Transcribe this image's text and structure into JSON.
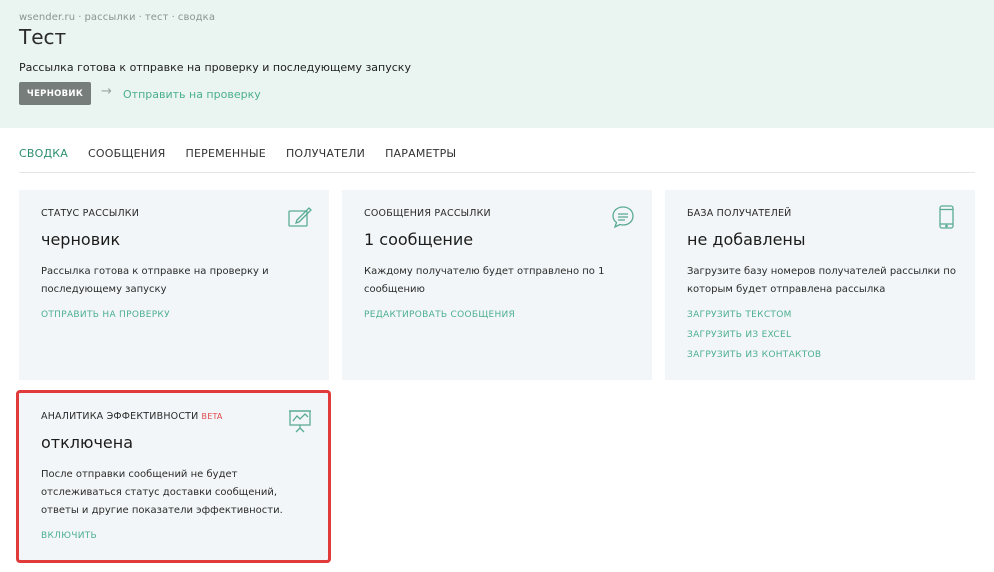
{
  "breadcrumb": [
    "wsender.ru",
    "рассылки",
    "тест",
    "сводка"
  ],
  "breadcrumb_separator": "·",
  "page_title": "Тест",
  "status_line": "Рассылка готова к отправке на проверку и последующему запуску",
  "status_pill": "ЧЕРНОВИК",
  "arrow": "→",
  "send_link": "Отправить на проверку",
  "tabs": [
    "СВОДКА",
    "СООБЩЕНИЯ",
    "ПЕРЕМЕННЫЕ",
    "ПОЛУЧАТЕЛИ",
    "ПАРАМЕТРЫ"
  ],
  "active_tab": "СВОДКА",
  "cards": [
    {
      "title": "СТАТУС РАССЫЛКИ",
      "value": "черновик",
      "description": "Рассылка готова к отправке на проверку и последующему запуску",
      "links": [
        "ОТПРАВИТЬ НА ПРОВЕРКУ"
      ],
      "icon": "edit-icon"
    },
    {
      "title": "СООБЩЕНИЯ РАССЫЛКИ",
      "value": "1 сообщение",
      "description": "Каждому получателю будет отправлено по 1 сообщению",
      "links": [
        "РЕДАКТИРОВАТЬ СООБЩЕНИЯ"
      ],
      "icon": "chat-icon"
    },
    {
      "title": "БАЗА ПОЛУЧАТЕЛЕЙ",
      "value": "не добавлены",
      "description": "Загрузите базу номеров получателей рассылки по которым будет отправлена рассылка",
      "links": [
        "ЗАГРУЗИТЬ ТЕКСТОМ",
        "ЗАГРУЗИТЬ ИЗ EXCEL",
        "ЗАГРУЗИТЬ ИЗ КОНТАКТОВ"
      ],
      "icon": "phone-icon"
    },
    {
      "title": "АНАЛИТИКА ЭФФЕКТИВНОСТИ",
      "badge": "BETA",
      "value": "отключена",
      "description": "После отправки сообщений не будет отслеживаться статус доставки сообщений, ответы и другие показатели эффективности.",
      "links": [
        "ВКЛЮЧИТЬ"
      ],
      "icon": "presentation-chart-icon"
    }
  ],
  "colors": {
    "header_bg": "#eaf4f0",
    "accent": "#4caf8f",
    "card_bg": "#f3f6f8",
    "pill_bg": "#777d7b",
    "highlight": "#e03a3a",
    "beta": "#e04848"
  }
}
